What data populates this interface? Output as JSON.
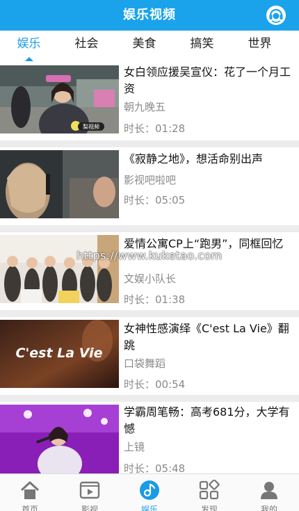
{
  "header": {
    "title": "娱乐视频"
  },
  "tabs": [
    {
      "label": "娱乐",
      "active": true
    },
    {
      "label": "社会",
      "active": false
    },
    {
      "label": "美食",
      "active": false
    },
    {
      "label": "搞笑",
      "active": false
    },
    {
      "label": "世界",
      "active": false
    }
  ],
  "videos": [
    {
      "title": "女白领应援吴宣仪：花了一个月工资",
      "source": "朝九晚五",
      "duration": "时长：01:28",
      "thumb_badge": "梨视频",
      "thumb_text": ""
    },
    {
      "title": "《寂静之地》，想活命别出声",
      "source": "影视吧啦吧",
      "duration": "时长：05:05",
      "thumb_badge": "",
      "thumb_text": ""
    },
    {
      "title": "爱情公寓CP上“跑男”，同框回忆",
      "source": "文娱小队长",
      "duration": "时长：01:38",
      "thumb_badge": "",
      "thumb_text": ""
    },
    {
      "title": "女神性感演绎《C'est La Vie》翻跳",
      "source": "口袋舞蹈",
      "duration": "时长：00:54",
      "thumb_badge": "",
      "thumb_text": "C'est La Vie"
    },
    {
      "title": "学霸周笔畅：高考681分，大学有憾",
      "source": "上镜",
      "duration": "时长：05:48",
      "thumb_badge": "",
      "thumb_text": ""
    }
  ],
  "watermark": "https://www.kuketao.com",
  "nav": [
    {
      "label": "首页",
      "icon": "home-icon",
      "active": false
    },
    {
      "label": "影视",
      "icon": "tv-icon",
      "active": false
    },
    {
      "label": "娱乐",
      "icon": "music-icon",
      "active": true
    },
    {
      "label": "发现",
      "icon": "discover-icon",
      "active": false
    },
    {
      "label": "我的",
      "icon": "user-icon",
      "active": false
    }
  ],
  "colors": {
    "primary": "#1aa3eb",
    "accent": "#1a9be6",
    "meta_text": "#8a8a8a"
  }
}
